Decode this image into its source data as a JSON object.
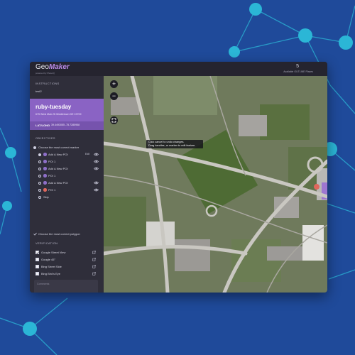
{
  "app": {
    "logo_geo": "Geo",
    "logo_maker": "Maker",
    "logo_sub": "powered by PlaceIQ",
    "poi_count": "5",
    "poi_caption": "Available OUTLINE Places"
  },
  "sidebar": {
    "instructions_title": "INSTRUCTIONS",
    "instructions_value": "test2",
    "location": {
      "name": "ruby-tuesday",
      "address": "675 West Main St Middletown DE 19709",
      "latlong_label": "LAT/LONG",
      "latlong_value": "39.4493055 -75.7285958"
    },
    "objectives_title": "OBJECTIVES",
    "objective_marker": "Choose the most correct marker",
    "edit_label": "Edit",
    "markers": [
      {
        "label": "Add A New POI",
        "color": "#8e6fc8",
        "selected": true,
        "has_eye": true,
        "has_edit": true
      },
      {
        "label": "POI 1",
        "color": "#8e6fc8",
        "selected": false,
        "has_eye": true,
        "has_edit": false
      },
      {
        "label": "Add A New POI",
        "color": "#8e6fc8",
        "selected": false,
        "has_eye": true,
        "has_edit": false
      },
      {
        "label": "POI 1",
        "color": "#8e6fc8",
        "selected": false,
        "has_eye": false,
        "has_edit": false
      },
      {
        "label": "Add A New POI",
        "color": "#8e6fc8",
        "selected": false,
        "has_eye": true,
        "has_edit": false
      },
      {
        "label": "POI 1",
        "color": "#e0675c",
        "selected": false,
        "has_eye": true,
        "has_edit": false
      },
      {
        "label": "Skip",
        "color": "",
        "selected": false,
        "has_eye": false,
        "has_edit": false
      }
    ],
    "objective_polygon": "Choose the most correct polygon",
    "verification_title": "VERIFICATION",
    "verification": [
      {
        "label": "Google Street View",
        "checked": true
      },
      {
        "label": "Google 45°",
        "checked": false
      },
      {
        "label": "Bing Street Side",
        "checked": false
      },
      {
        "label": "Bing Bird's Eye",
        "checked": false
      }
    ],
    "comments_placeholder": "Comments"
  },
  "map": {
    "zoom_in": "+",
    "zoom_out": "−",
    "tooltip_line1": "Click cancel to undo changes.",
    "tooltip_line2": "Drag handles, or marker to edit feature."
  },
  "colors": {
    "accent": "#8a63c4",
    "background": "#1f4a9a",
    "network_node": "#2bb6d6",
    "marker_red": "#e0675c"
  }
}
